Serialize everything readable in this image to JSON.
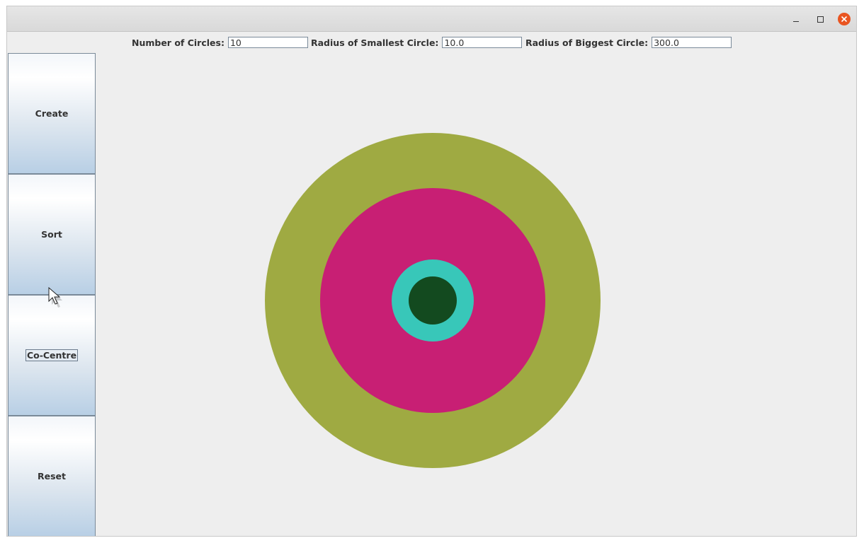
{
  "window": {
    "controls": [
      "minimize-icon",
      "maximize-icon",
      "close-icon"
    ],
    "close_color": "#e95420"
  },
  "toolbar": {
    "num_circles_label": "Number of Circles:",
    "num_circles_value": "10",
    "smallest_label": "Radius of Smallest Circle:",
    "smallest_value": "10.0",
    "biggest_label": "Radius of Biggest Circle:",
    "biggest_value": "300.0"
  },
  "sidebar": {
    "buttons": [
      {
        "label": "Create"
      },
      {
        "label": "Sort"
      },
      {
        "label": "Co-Centre",
        "focused": true
      },
      {
        "label": "Reset"
      }
    ]
  },
  "canvas": {
    "background": "#eeeeee",
    "circles": [
      {
        "color": "#9faa42"
      },
      {
        "color": "#c81f74"
      },
      {
        "color": "#38c7b9"
      },
      {
        "color": "#134a1f"
      }
    ]
  }
}
